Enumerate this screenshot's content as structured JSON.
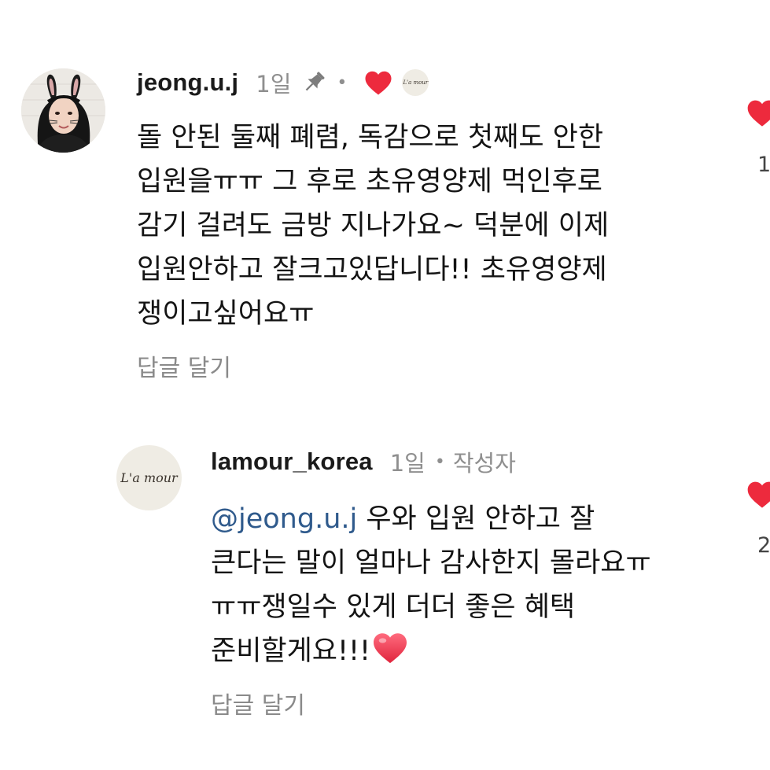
{
  "comments": [
    {
      "username": "jeong.u.j",
      "time": "1일",
      "separator": "•",
      "lines": [
        "돌 안된 둘째 폐렴, 독감으로 첫째도 안한",
        "입원을ㅠㅠ 그 후로 초유영양제 먹인후로",
        "감기 걸려도 금방 지나가요~ 덕분에 이제",
        "입원안하고 잘크고있답니다!! 초유영양제",
        "쟁이고싶어요ㅠ"
      ],
      "reply_label": "답글 달기",
      "like_count": "1"
    },
    {
      "username": "lamour_korea",
      "time": "1일",
      "separator": "•",
      "author_tag": "작성자",
      "mention": "@jeong.u.j",
      "lines": [
        " 우와 입원 안하고 잘",
        "큰다는 말이 얼마나 감사한지 몰라요ㅠ",
        "ㅠㅠ쟁일수 있게 더더 좋은 혜택",
        "준비할게요!!!"
      ],
      "reply_label": "답글 달기",
      "like_count": "2"
    }
  ],
  "brand_logo": "L'a mour",
  "colors": {
    "heart": "#ed2a3d",
    "meta_gray": "#8f8f8f",
    "mention_blue": "#2f5a8c"
  },
  "icons": {
    "pin": "pin-icon",
    "heart": "heart-icon"
  }
}
